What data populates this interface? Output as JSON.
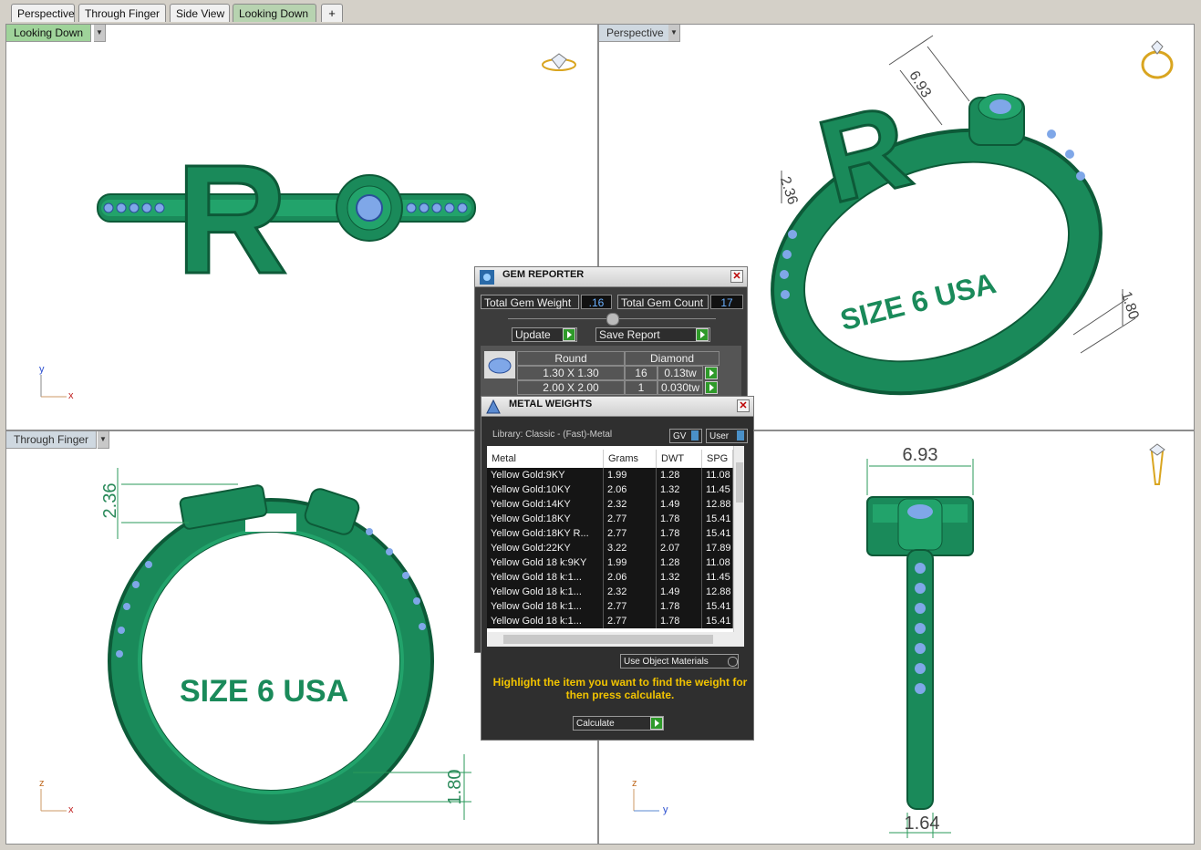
{
  "tabs": [
    {
      "label": "Perspective",
      "active": false
    },
    {
      "label": "Through Finger",
      "active": false
    },
    {
      "label": "Side View",
      "active": false
    },
    {
      "label": "Looking Down",
      "active": true
    },
    {
      "label": "+",
      "active": false
    }
  ],
  "viewports": {
    "top_left": {
      "label": "Looking Down",
      "axis_a": "y",
      "axis_b": "x",
      "monogram": "R"
    },
    "top_right": {
      "label": "Perspective",
      "dim_top": "6.93",
      "dim_side": "2.36",
      "dim_band": "1.80",
      "band_text": "SIZE 6 USA",
      "monogram": "R"
    },
    "bottom_left": {
      "label": "Through Finger",
      "dim_top": "2.36",
      "dim_band": "1.80",
      "band_text": "SIZE 6 USA",
      "axis_a": "z",
      "axis_b": "x"
    },
    "bottom_right": {
      "label": "",
      "dim_top": "6.93",
      "dim_bottom": "1.64",
      "axis_a": "z",
      "axis_b": "y"
    }
  },
  "gem_reporter": {
    "title": "GEM REPORTER",
    "total_weight_label": "Total Gem Weight",
    "total_weight_value": ".16",
    "total_count_label": "Total Gem Count",
    "total_count_value": "17",
    "update_label": "Update",
    "save_label": "Save Report",
    "shape": "Round",
    "material": "Diamond",
    "rows": [
      {
        "size": "1.30 X 1.30",
        "count": "16",
        "weight": "0.13tw"
      },
      {
        "size": "2.00 X 2.00",
        "count": "1",
        "weight": "0.030tw"
      }
    ]
  },
  "metal_weights": {
    "title": "METAL WEIGHTS",
    "library": "Library: Classic - (Fast)-Metal",
    "gv_label": "GV",
    "user_label": "User",
    "columns": [
      "Metal",
      "Grams",
      "DWT",
      "SPG"
    ],
    "rows": [
      {
        "metal": "Yellow Gold:9KY",
        "grams": "1.99",
        "dwt": "1.28",
        "spg": "11.08"
      },
      {
        "metal": "Yellow Gold:10KY",
        "grams": "2.06",
        "dwt": "1.32",
        "spg": "11.45"
      },
      {
        "metal": "Yellow Gold:14KY",
        "grams": "2.32",
        "dwt": "1.49",
        "spg": "12.88"
      },
      {
        "metal": "Yellow Gold:18KY",
        "grams": "2.77",
        "dwt": "1.78",
        "spg": "15.41"
      },
      {
        "metal": "Yellow Gold:18KY R...",
        "grams": "2.77",
        "dwt": "1.78",
        "spg": "15.41"
      },
      {
        "metal": "Yellow Gold:22KY",
        "grams": "3.22",
        "dwt": "2.07",
        "spg": "17.89"
      },
      {
        "metal": "Yellow Gold 18 k:9KY",
        "grams": "1.99",
        "dwt": "1.28",
        "spg": "11.08"
      },
      {
        "metal": "Yellow Gold 18 k:1...",
        "grams": "2.06",
        "dwt": "1.32",
        "spg": "11.45"
      },
      {
        "metal": "Yellow Gold 18 k:1...",
        "grams": "2.32",
        "dwt": "1.49",
        "spg": "12.88"
      },
      {
        "metal": "Yellow Gold 18 k:1...",
        "grams": "2.77",
        "dwt": "1.78",
        "spg": "15.41"
      },
      {
        "metal": "Yellow Gold 18 k:1...",
        "grams": "2.77",
        "dwt": "1.78",
        "spg": "15.41"
      }
    ],
    "use_object_materials": "Use Object Materials",
    "hint": "Highlight the item you want to find the weight for then press calculate.",
    "calculate_label": "Calculate"
  },
  "colors": {
    "ring_green": "#1a8a5a",
    "ring_dark": "#0d5a38",
    "stone_blue": "#7fa7e8",
    "hint_yellow": "#f2c400"
  }
}
